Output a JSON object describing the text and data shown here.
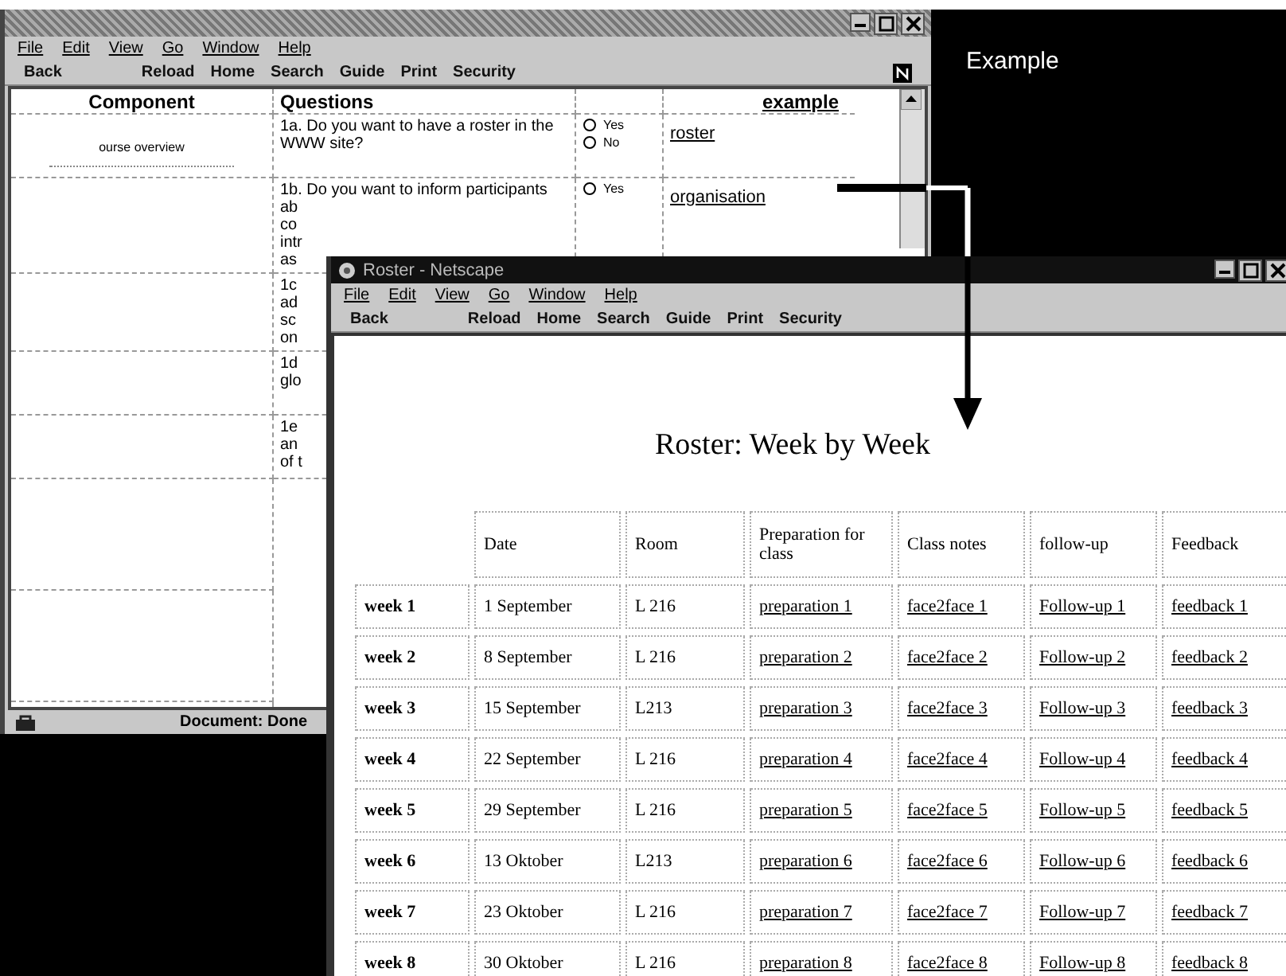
{
  "back_window": {
    "menu": [
      "File",
      "Edit",
      "View",
      "Go",
      "Window",
      "Help"
    ],
    "toolbar": [
      "Back",
      "Reload",
      "Home",
      "Search",
      "Guide",
      "Print",
      "Security"
    ],
    "table": {
      "columns": [
        "Component",
        "Questions",
        "",
        "example"
      ],
      "rows": [
        {
          "component": "ourse overview",
          "lines": [
            "1a. Do you want to have a roster in the",
            "WWW site?"
          ],
          "options": [
            {
              "label": "Yes",
              "selected": false
            },
            {
              "label": "No",
              "selected": false
            }
          ],
          "example": "roster"
        },
        {
          "lines": [
            "1b. Do you want to inform participants",
            "ab",
            "co",
            "intr",
            "as"
          ],
          "options": [
            {
              "label": "Yes",
              "selected": false
            }
          ],
          "example": "organisation"
        },
        {
          "lines": [
            "1c",
            "ad",
            "sc",
            "on"
          ],
          "options": []
        },
        {
          "lines": [
            "1d",
            "glo"
          ],
          "options": []
        },
        {
          "lines": [
            "1e",
            "an",
            "of t"
          ],
          "options": []
        }
      ]
    },
    "status": "Document: Done"
  },
  "annotation": {
    "label": "Example"
  },
  "front_window": {
    "title": "Roster - Netscape",
    "menu": [
      "File",
      "Edit",
      "View",
      "Go",
      "Window",
      "Help"
    ],
    "toolbar": [
      "Back",
      "Reload",
      "Home",
      "Search",
      "Guide",
      "Print",
      "Security"
    ],
    "heading": "Roster: Week by Week",
    "columns": [
      "",
      "Date",
      "Room",
      "Preparation for class",
      "Class notes",
      "follow-up",
      "Feedback"
    ],
    "rows": [
      {
        "week": "week 1",
        "date": "1 September",
        "room": "L 216",
        "preparation": "preparation 1",
        "notes": "face2face 1",
        "follow_up": "Follow-up 1",
        "feedback": "feedback 1"
      },
      {
        "week": "week 2",
        "date": "8 September",
        "room": "L 216",
        "preparation": "preparation 2",
        "notes": "face2face 2",
        "follow_up": "Follow-up 2",
        "feedback": "feedback 2"
      },
      {
        "week": "week 3",
        "date": "15 September",
        "room": "L213",
        "preparation": "preparation 3",
        "notes": "face2face 3",
        "follow_up": "Follow-up 3",
        "feedback": "feedback 3"
      },
      {
        "week": "week 4",
        "date": "22 September",
        "room": "L 216",
        "preparation": "preparation 4",
        "notes": "face2face 4",
        "follow_up": "Follow-up 4",
        "feedback": "feedback 4"
      },
      {
        "week": "week 5",
        "date": "29 September",
        "room": "L 216",
        "preparation": "preparation 5",
        "notes": "face2face 5",
        "follow_up": "Follow-up 5",
        "feedback": "feedback 5"
      },
      {
        "week": "week 6",
        "date": "13 Oktober",
        "room": "L213",
        "preparation": "preparation 6",
        "notes": "face2face 6",
        "follow_up": "Follow-up 6",
        "feedback": "feedback 6"
      },
      {
        "week": "week 7",
        "date": "23 Oktober",
        "room": "L 216",
        "preparation": "preparation 7",
        "notes": "face2face 7",
        "follow_up": "Follow-up 7",
        "feedback": "feedback 7"
      },
      {
        "week": "week 8",
        "date": "30 Oktober",
        "room": "L 216",
        "preparation": "preparation 8",
        "notes": "face2face 8",
        "follow_up": "Follow-up 8",
        "feedback": "feedback 8"
      }
    ]
  }
}
